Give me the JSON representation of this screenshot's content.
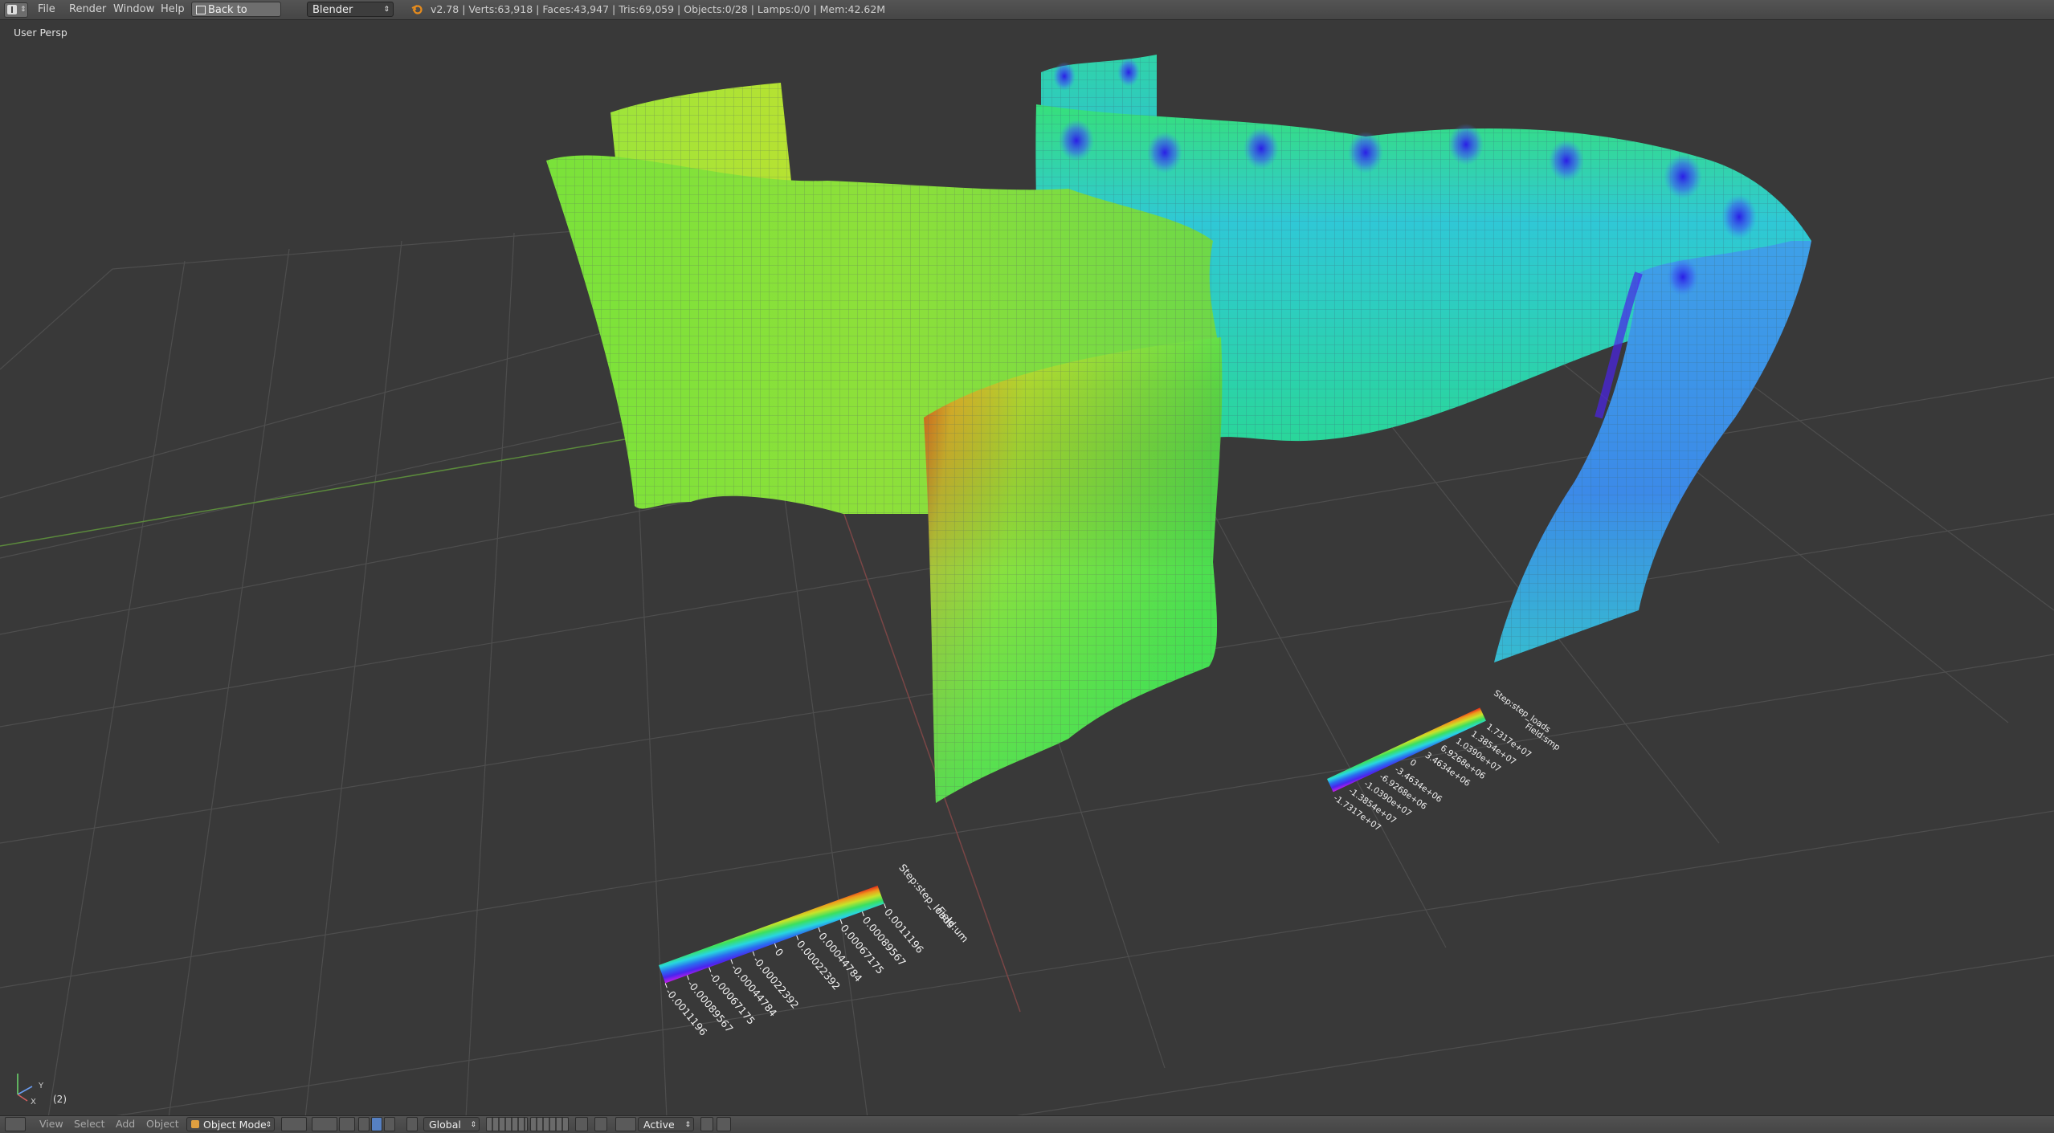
{
  "topbar": {
    "menus": [
      "File",
      "Render",
      "Window",
      "Help"
    ],
    "back_button": "Back to Previous",
    "render_engine": "Blender Render",
    "stats": "v2.78 | Verts:63,918 | Faces:43,947 | Tris:69,059 | Objects:0/28 | Lamps:0/0 | Mem:42.62M"
  },
  "viewport": {
    "view_name": "User Persp",
    "frame": "(2)",
    "axis_labels": {
      "y": "Y",
      "x": "X"
    }
  },
  "legend_left": {
    "title": "Step:step_loads",
    "subtitle": "Field:um",
    "ticks": [
      "0.0011196",
      "0.00089567",
      "0.00067175",
      "0.00044784",
      "0.00022392",
      "0",
      "-0.00022392",
      "-0.00044784",
      "-0.00067175",
      "-0.00089567",
      "-0.0011196"
    ]
  },
  "legend_right": {
    "title": "Step:step_loads",
    "subtitle": "Field:smp",
    "ticks": [
      "1.7317e+07",
      "1.3854e+07",
      "1.0390e+07",
      "6.9268e+06",
      "3.4634e+06",
      "0",
      "-3.4634e+06",
      "-6.9268e+06",
      "-1.0390e+07",
      "-1.3854e+07",
      "-1.7317e+07"
    ]
  },
  "bottombar": {
    "menus": [
      "View",
      "Select",
      "Add",
      "Object"
    ],
    "mode": "Object Mode",
    "orientation": "Global",
    "pivot": "Active"
  },
  "colors": {
    "background": "#393939",
    "grid": "#4d4d4d",
    "x_axis": "#7a4646",
    "y_axis": "#5b8a3c",
    "active_button": "#5680c2"
  }
}
